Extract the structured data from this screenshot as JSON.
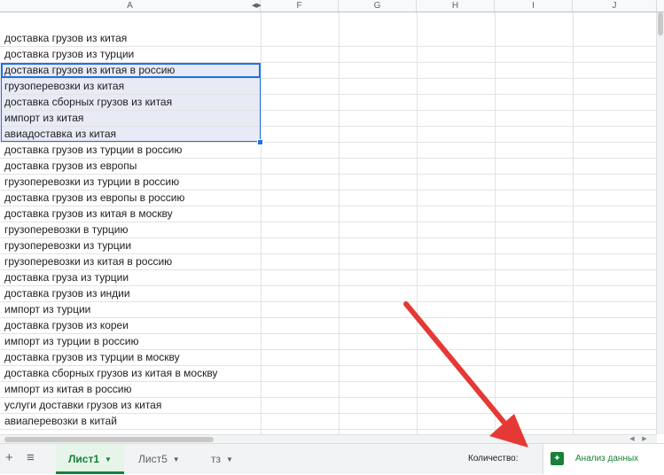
{
  "columns": [
    "A",
    "F",
    "G",
    "H",
    "I",
    "J"
  ],
  "rows": [
    "доставка грузов из китая",
    "доставка грузов из турции",
    "доставка грузов из китая в россию",
    "грузоперевозки из китая",
    "доставка сборных грузов из китая",
    "импорт из китая",
    "авиадоставка из китая",
    "доставка грузов из турции в россию",
    "доставка грузов из европы",
    "грузоперевозки из турции в россию",
    "доставка грузов из европы в россию",
    "доставка грузов из китая в москву",
    "грузоперевозки в турцию",
    "грузоперевозки из турции",
    "грузоперевозки из китая в россию",
    "доставка груза из турции",
    "доставка грузов из индии",
    "импорт из турции",
    "доставка грузов из кореи",
    "импорт из турции в россию",
    "доставка грузов из турции в москву",
    "доставка сборных грузов из китая в москву",
    "импорт из китая в россию",
    "услуги доставки грузов из китая",
    "авиаперевозки в китай"
  ],
  "selection": {
    "first_row": 2,
    "last_row": 6
  },
  "tabs": [
    {
      "label": "Лист1",
      "active": true
    },
    {
      "label": "Лист5",
      "active": false
    },
    {
      "label": "тз",
      "active": false
    }
  ],
  "toolbar": {
    "add_icon": "+",
    "list_icon": "≡"
  },
  "status": {
    "count_label": "Количество:"
  },
  "explore": {
    "label": "Анализ данных",
    "icon": "explore-icon"
  },
  "colors": {
    "accent": "#1a73e8",
    "green": "#188038",
    "arrow": "#e53935"
  }
}
